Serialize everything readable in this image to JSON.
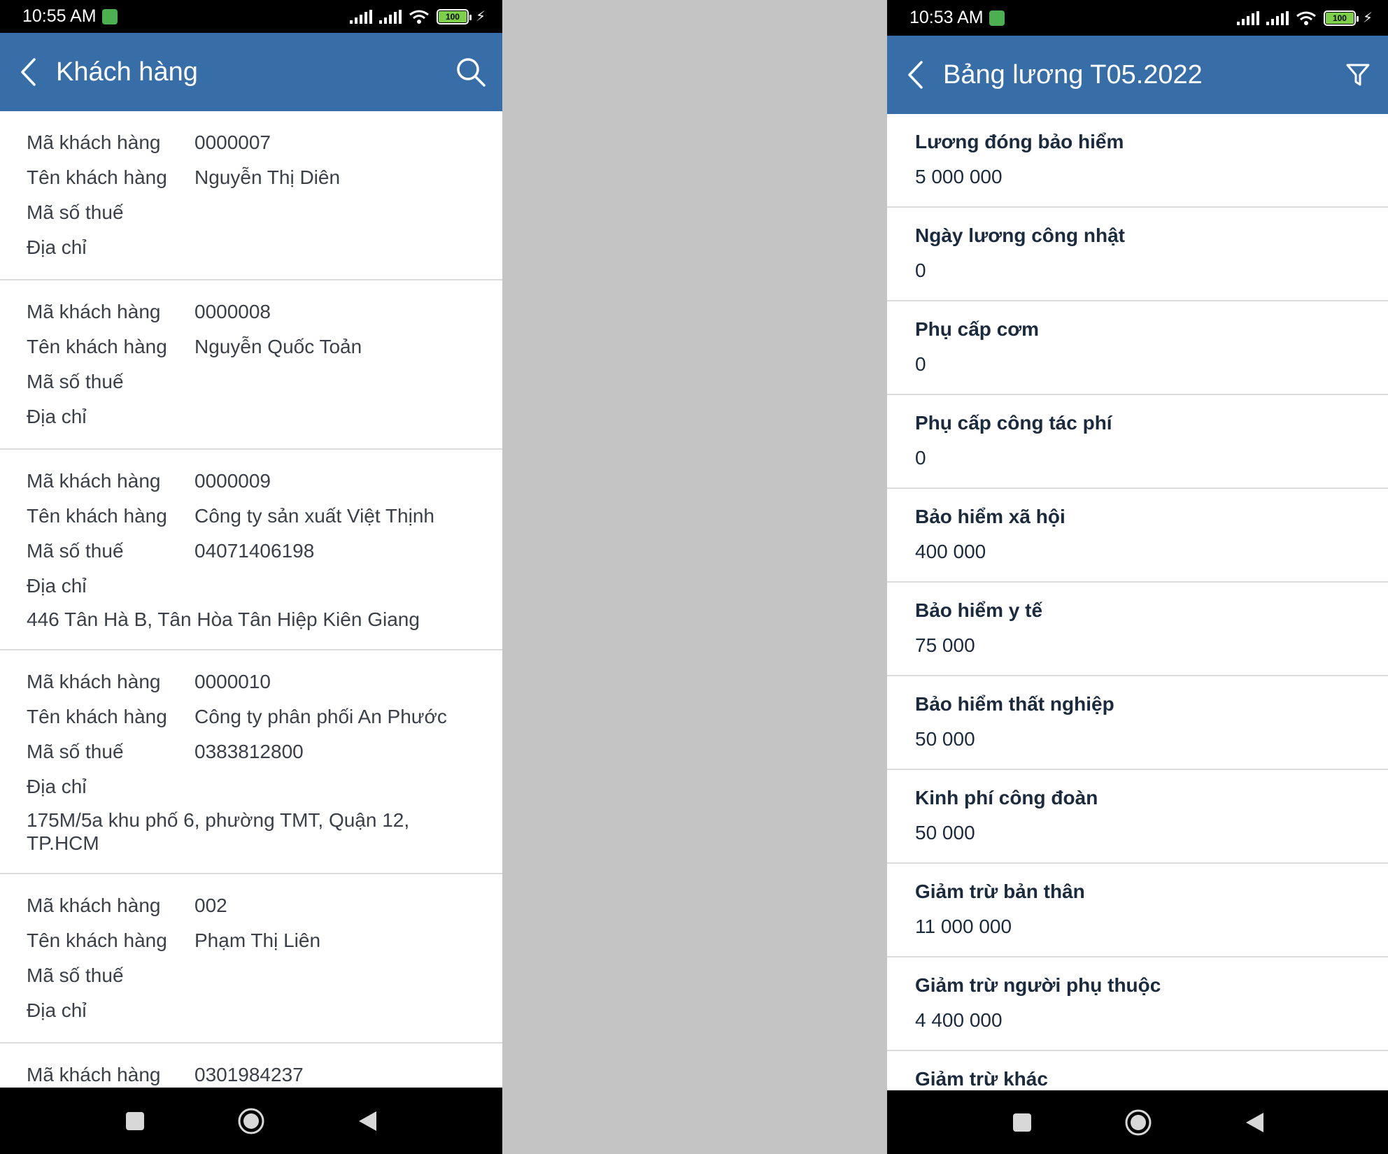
{
  "left_screen": {
    "status": {
      "time": "10:55 AM",
      "battery": "100"
    },
    "title": "Khách hàng",
    "field_labels": {
      "code": "Mã khách hàng",
      "name": "Tên khách hàng",
      "tax": "Mã số thuế",
      "address": "Địa chỉ"
    },
    "customers": [
      {
        "code": "0000007",
        "name": "Nguyễn Thị Diên",
        "tax": "",
        "address": ""
      },
      {
        "code": "0000008",
        "name": "Nguyễn Quốc Toản",
        "tax": "",
        "address": ""
      },
      {
        "code": "0000009",
        "name": "Công ty sản xuất Việt Thịnh",
        "tax": "04071406198",
        "address": "446 Tân Hà B, Tân Hòa Tân Hiệp Kiên Giang"
      },
      {
        "code": "0000010",
        "name": "Công ty phân phối An Phước",
        "tax": "0383812800",
        "address": "175M/5a khu phố 6, phường TMT, Quận 12, TP.HCM"
      },
      {
        "code": "002",
        "name": "Phạm Thị Liên",
        "tax": "",
        "address": ""
      },
      {
        "code": "0301984237",
        "name": "",
        "tax": "",
        "address": ""
      }
    ]
  },
  "right_screen": {
    "status": {
      "time": "10:53 AM",
      "battery": "100"
    },
    "title": "Bảng lương T05.2022",
    "items": [
      {
        "label": "Lương đóng bảo hiểm",
        "value": "5 000 000"
      },
      {
        "label": "Ngày lương công nhật",
        "value": "0"
      },
      {
        "label": "Phụ cấp cơm",
        "value": "0"
      },
      {
        "label": "Phụ cấp công tác phí",
        "value": "0"
      },
      {
        "label": "Bảo hiểm xã hội",
        "value": "400 000"
      },
      {
        "label": "Bảo hiểm y tế",
        "value": "75 000"
      },
      {
        "label": "Bảo hiểm thất nghiệp",
        "value": "50 000"
      },
      {
        "label": "Kinh phí công đoàn",
        "value": "50 000"
      },
      {
        "label": "Giảm trừ bản thân",
        "value": "11 000 000"
      },
      {
        "label": "Giảm trừ người phụ thuộc",
        "value": "4 400 000"
      },
      {
        "label": "Giảm trừ khác",
        "value": ""
      }
    ]
  }
}
